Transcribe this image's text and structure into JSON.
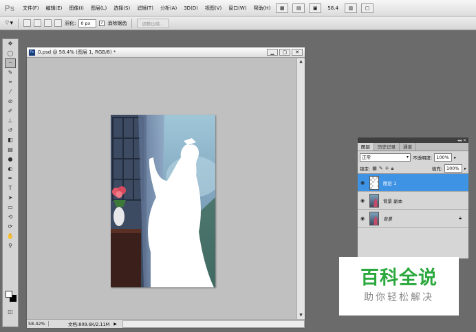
{
  "app": {
    "logo_text": "Ps"
  },
  "menu": {
    "items": [
      "文件(F)",
      "编辑(E)",
      "图像(I)",
      "图层(L)",
      "选择(S)",
      "滤镜(T)",
      "分析(A)",
      "3D(D)",
      "视图(V)",
      "窗口(W)",
      "帮助(H)"
    ],
    "zoom_level": "58.4"
  },
  "options_bar": {
    "feather_label": "羽化:",
    "feather_value": "0 px",
    "antialias_label": "消除锯齿",
    "refine_edge_label": "调整边缘..."
  },
  "document": {
    "title": "0.psd @ 58.4% (图层 1, RGB/8) *",
    "status_zoom": "58.42%",
    "status_info": "文档:809.6K/2.11M"
  },
  "layers_panel": {
    "tabs": [
      "图层",
      "历史记录",
      "通道"
    ],
    "blend_mode": "正常",
    "opacity_label": "不透明度:",
    "opacity_value": "100%",
    "lock_label": "锁定:",
    "fill_label": "填充:",
    "fill_value": "100%",
    "layers": [
      {
        "name": "图层 1",
        "selected": true
      },
      {
        "name": "背景 副本",
        "selected": false
      },
      {
        "name": "背景",
        "selected": false,
        "locked": true
      }
    ]
  },
  "watermark": {
    "title": "百科全说",
    "subtitle": "助你轻松解决"
  },
  "colors": {
    "accent": "#3f93e4",
    "watermark_green": "#2aa83c"
  }
}
